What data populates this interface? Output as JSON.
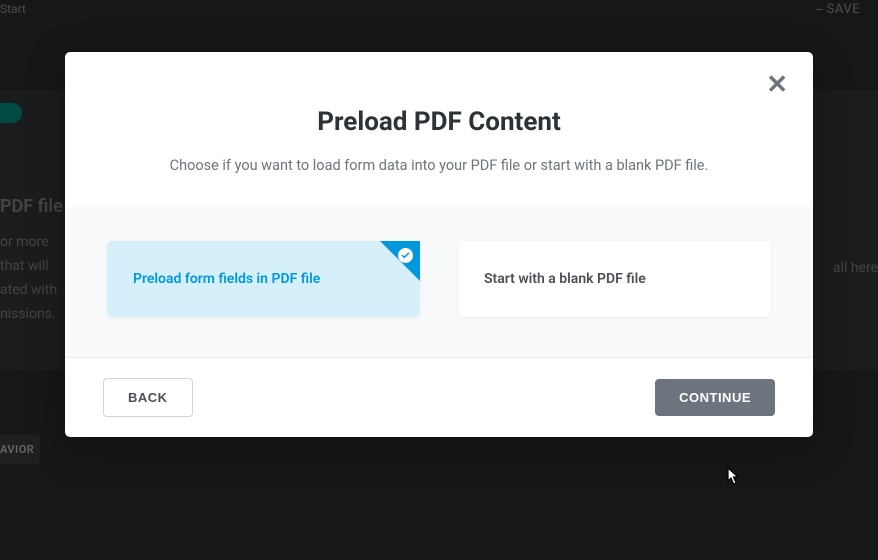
{
  "bg": {
    "start": "Start",
    "topRight": "⎯ SAVE",
    "pdfFile": "PDF file",
    "line1": "or more",
    "line2": "that will",
    "line3": "ated with",
    "line4": "nissions.",
    "rightText": "all here",
    "bgButton": "AVIOR"
  },
  "modal": {
    "title": "Preload PDF Content",
    "subtitle": "Choose if you want to load form data into your PDF file or start with a blank PDF file.",
    "options": {
      "preload": "Preload form fields in PDF file",
      "blank": "Start with a blank PDF file"
    },
    "buttons": {
      "back": "BACK",
      "continue": "CONTINUE"
    }
  }
}
